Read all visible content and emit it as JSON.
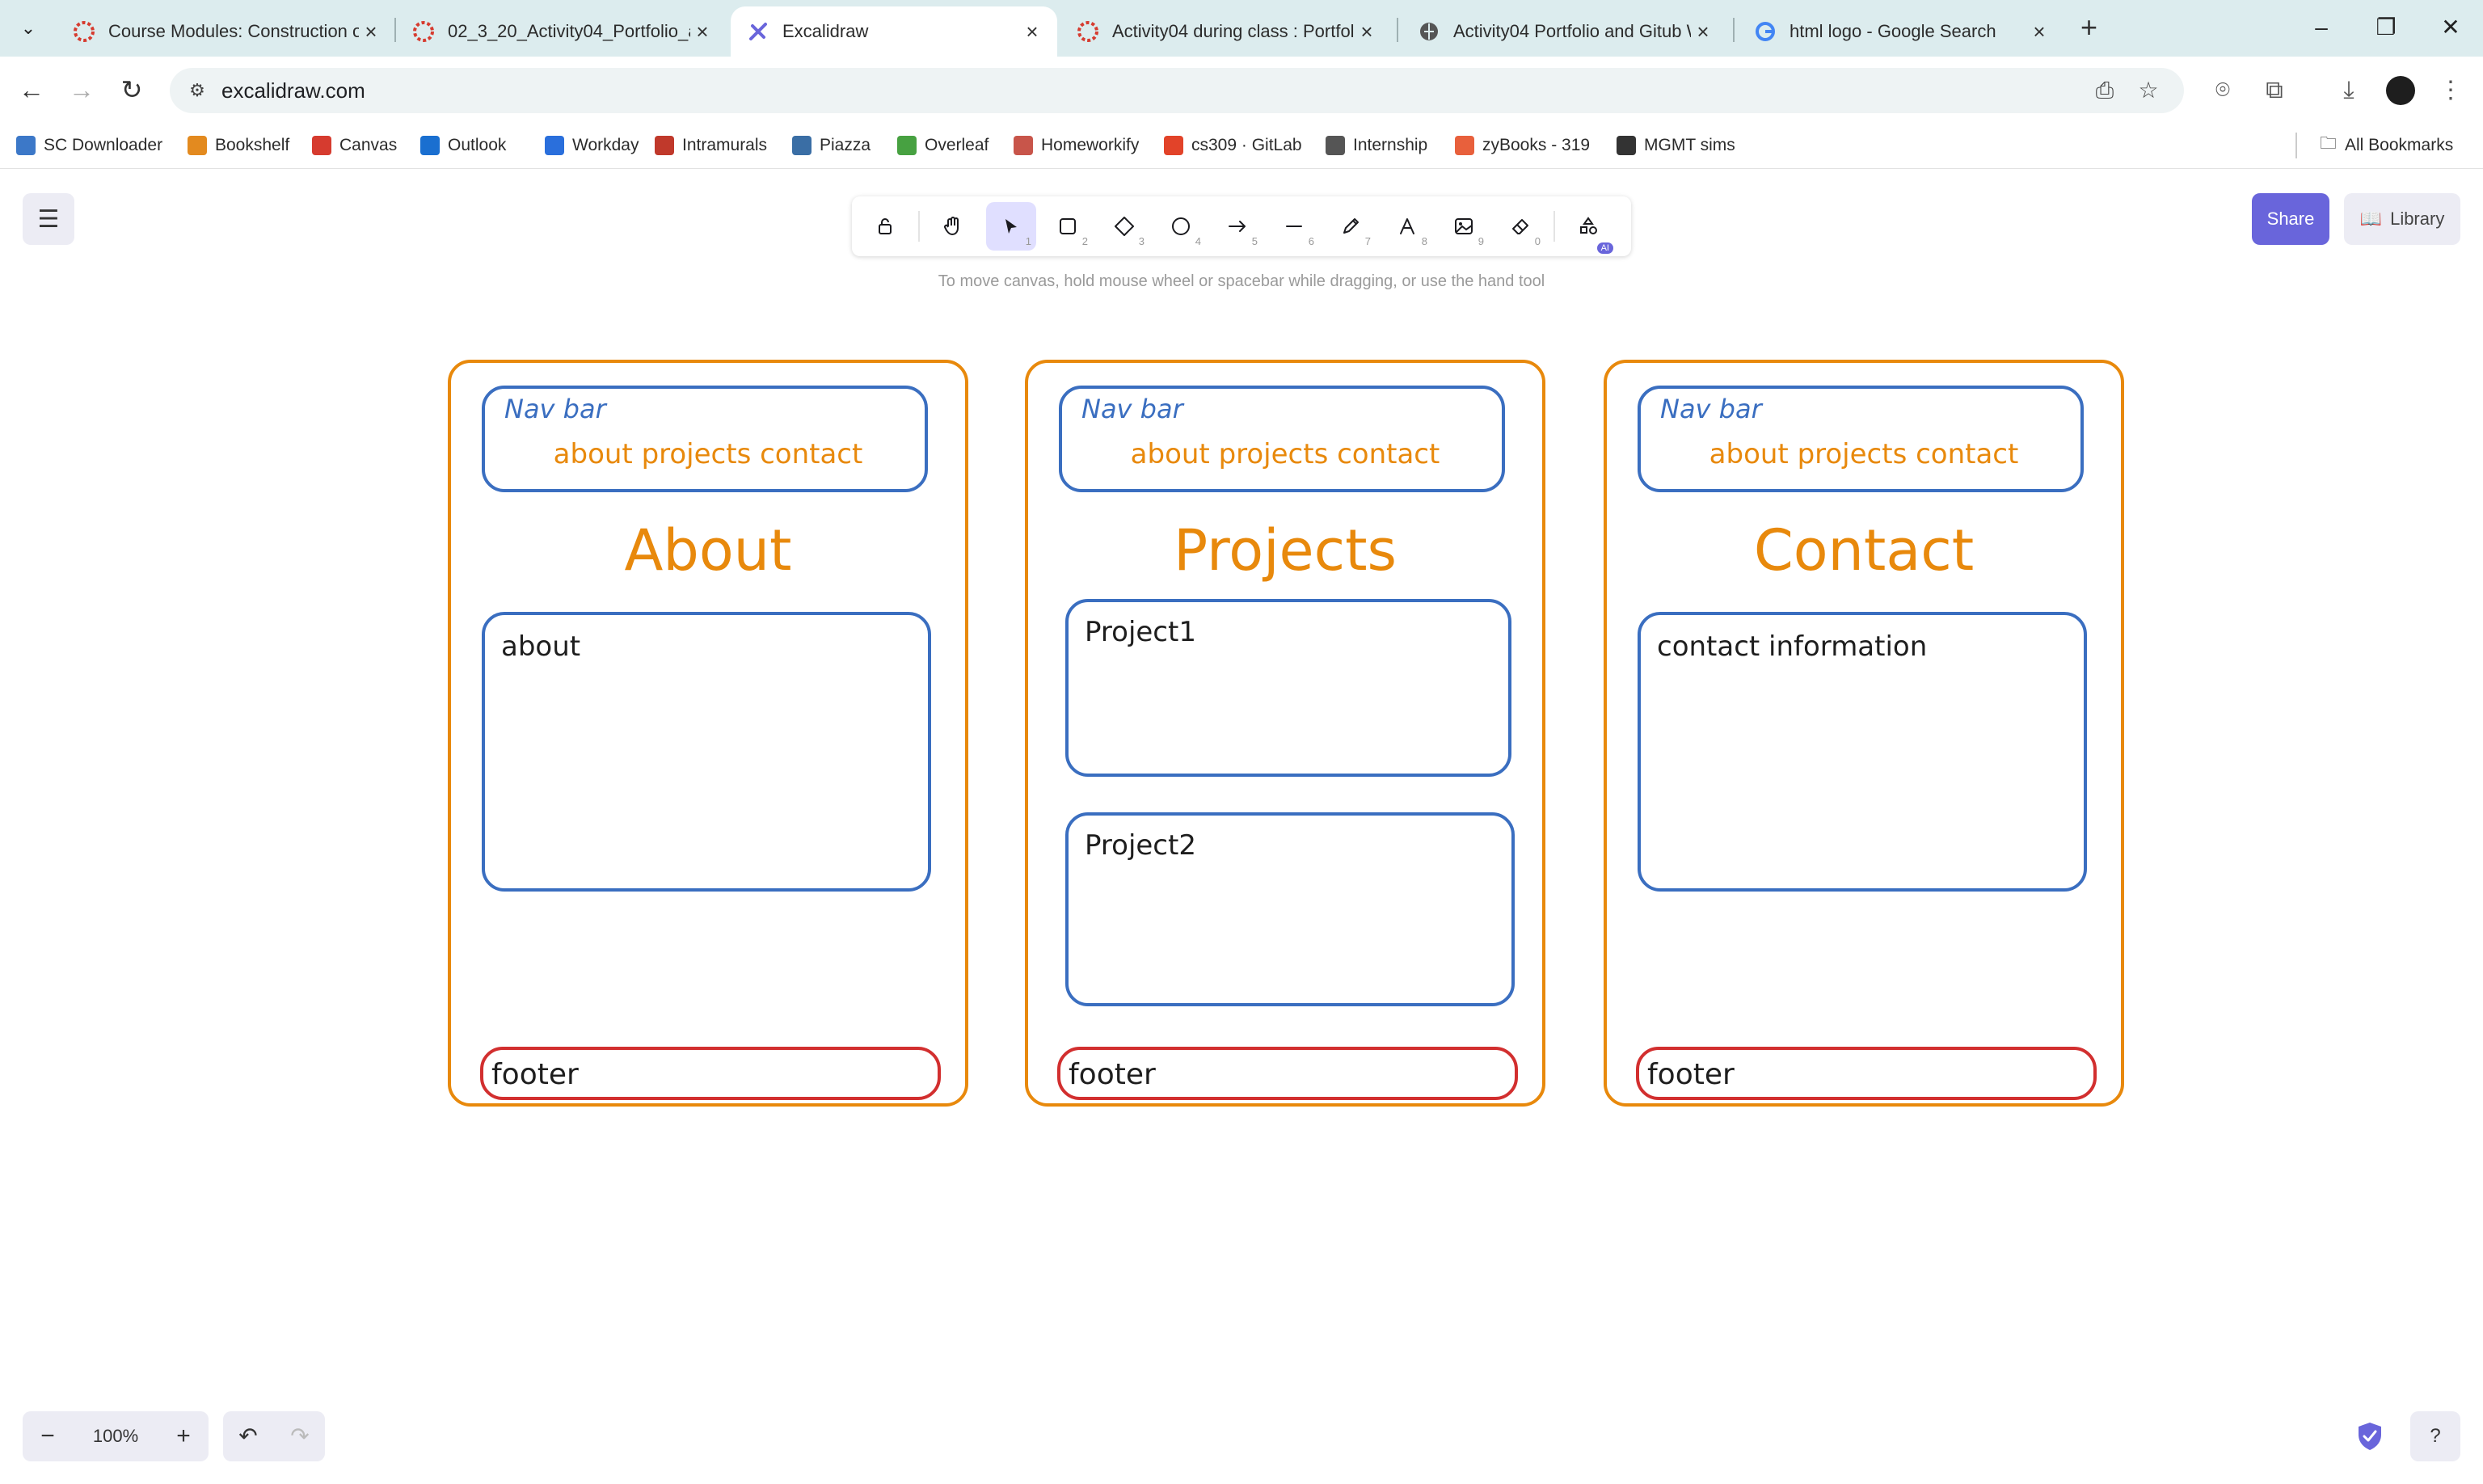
{
  "browser": {
    "tabs": [
      {
        "title": "Course Modules: Construction o",
        "favicon": "canvas-logo-icon",
        "active": false
      },
      {
        "title": "02_3_20_Activity04_Portfolio_an",
        "favicon": "canvas-logo-icon",
        "active": false
      },
      {
        "title": "Excalidraw",
        "favicon": "excalidraw-logo-icon",
        "active": true
      },
      {
        "title": "Activity04 during class : Portfoli",
        "favicon": "canvas-logo-icon",
        "active": false
      },
      {
        "title": "Activity04 Portfolio and Gitub W",
        "favicon": "globe-icon",
        "active": false
      },
      {
        "title": "html logo - Google Search",
        "favicon": "google-logo-icon",
        "active": false
      }
    ],
    "url": "excalidraw.com",
    "bookmarks": [
      {
        "label": "SC Downloader",
        "color": "#3c78c8"
      },
      {
        "label": "Bookshelf",
        "color": "#e38a1f"
      },
      {
        "label": "Canvas",
        "color": "#d63b2f"
      },
      {
        "label": "Outlook",
        "color": "#1a6fd0"
      },
      {
        "label": "Workday",
        "color": "#2a6fdc"
      },
      {
        "label": "Intramurals",
        "color": "#c0392b"
      },
      {
        "label": "Piazza",
        "color": "#3a6ea5"
      },
      {
        "label": "Overleaf",
        "color": "#47a141"
      },
      {
        "label": "Homeworkify",
        "color": "#c8554a"
      },
      {
        "label": "cs309 · GitLab",
        "color": "#e24329"
      },
      {
        "label": "Internship",
        "color": "#555555"
      },
      {
        "label": "zyBooks - 319",
        "color": "#e8603c"
      },
      {
        "label": "MGMT sims",
        "color": "#333333"
      }
    ],
    "all_bookmarks_label": "All Bookmarks"
  },
  "excalidraw": {
    "tools": [
      {
        "name": "lock",
        "icon": "lock-icon",
        "key": ""
      },
      {
        "name": "hand",
        "icon": "hand-icon",
        "key": ""
      },
      {
        "name": "selection",
        "icon": "cursor-icon",
        "key": "1"
      },
      {
        "name": "rectangle",
        "icon": "rectangle-icon",
        "key": "2"
      },
      {
        "name": "diamond",
        "icon": "diamond-icon",
        "key": "3"
      },
      {
        "name": "ellipse",
        "icon": "ellipse-icon",
        "key": "4"
      },
      {
        "name": "arrow",
        "icon": "arrow-icon",
        "key": "5"
      },
      {
        "name": "line",
        "icon": "line-icon",
        "key": "6"
      },
      {
        "name": "draw",
        "icon": "pencil-icon",
        "key": "7"
      },
      {
        "name": "text",
        "icon": "text-icon",
        "key": "8"
      },
      {
        "name": "image",
        "icon": "image-icon",
        "key": "9"
      },
      {
        "name": "eraser",
        "icon": "eraser-icon",
        "key": "0"
      },
      {
        "name": "more",
        "icon": "shapes-ai-icon",
        "key": ""
      }
    ],
    "ai_badge": "AI",
    "hint": "To move canvas, hold mouse wheel or spacebar while dragging, or use the hand tool",
    "share_label": "Share",
    "library_label": "Library",
    "zoom": "100%",
    "accent": "#6965db"
  },
  "canvas": {
    "colors": {
      "orange": "#e8890c",
      "blue": "#3a6ec0",
      "red": "#d22f2f",
      "ink": "#1e1e1e"
    },
    "pages": [
      {
        "nav_label": "Nav bar",
        "nav_links": "about projects contact",
        "heading": "About",
        "boxes": [
          "about"
        ],
        "footer": "footer"
      },
      {
        "nav_label": "Nav bar",
        "nav_links": "about projects contact",
        "heading": "Projects",
        "boxes": [
          "Project1",
          "Project2"
        ],
        "footer": "footer"
      },
      {
        "nav_label": "Nav bar",
        "nav_links": "about projects contact",
        "heading": "Contact",
        "boxes": [
          "contact information"
        ],
        "footer": "footer"
      }
    ]
  }
}
